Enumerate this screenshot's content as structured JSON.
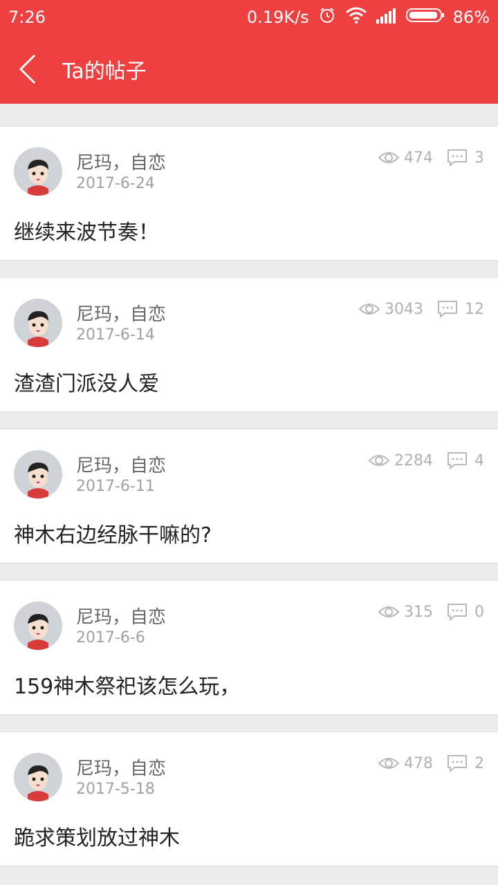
{
  "status": {
    "time": "7:26",
    "speed": "0.19K/s",
    "battery": "86%",
    "icons": [
      "alarm-icon",
      "wifi-icon",
      "signal-icon",
      "battery-icon"
    ]
  },
  "header": {
    "title": "Ta的帖子",
    "back_icon": "chevron-left-icon",
    "bg_color": "#ee4040"
  },
  "posts": [
    {
      "author": "尼玛，自恋",
      "date": "2017-6-24",
      "views": "474",
      "comments": "3",
      "content": "继续来波节奏！"
    },
    {
      "author": "尼玛，自恋",
      "date": "2017-6-14",
      "views": "3043",
      "comments": "12",
      "content": "渣渣门派没人爱"
    },
    {
      "author": "尼玛，自恋",
      "date": "2017-6-11",
      "views": "2284",
      "comments": "4",
      "content": "神木右边经脉干嘛的?"
    },
    {
      "author": "尼玛，自恋",
      "date": "2017-6-6",
      "views": "315",
      "comments": "0",
      "content": "159神木祭祀该怎么玩，"
    },
    {
      "author": "尼玛，自恋",
      "date": "2017-5-18",
      "views": "478",
      "comments": "2",
      "content": "跪求策划放过神木"
    }
  ]
}
